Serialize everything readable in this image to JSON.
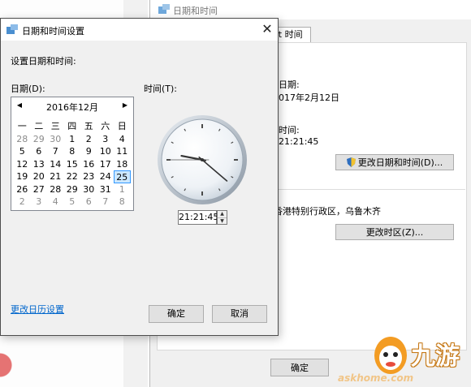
{
  "background_dialog": {
    "title": "日期和时间",
    "tab_label": "et 时间",
    "date_label": "日期:",
    "date_value": "017年2月12日",
    "time_label": "时间:",
    "time_value": "21:21:45",
    "change_datetime_button": "更改日期和时间(D)...",
    "timezone_value": "香港特别行政区，乌鲁木齐",
    "change_timezone_button": "更改时区(Z)...",
    "ok_button": "确定"
  },
  "watermark": {
    "brand": "九游",
    "url": "askhome.com"
  },
  "dialog": {
    "title": "日期和时间设置",
    "close_glyph": "✕",
    "heading": "设置日期和时间:",
    "date_label": "日期(D):",
    "time_label": "时间(T):",
    "calendar": {
      "month_label": "2016年12月",
      "prev_glyph": "◀",
      "next_glyph": "▶",
      "weekdays": [
        "一",
        "二",
        "三",
        "四",
        "五",
        "六",
        "日"
      ],
      "weeks": [
        [
          "28",
          "29",
          "30",
          "1",
          "2",
          "3",
          "4"
        ],
        [
          "5",
          "6",
          "7",
          "8",
          "9",
          "10",
          "11"
        ],
        [
          "12",
          "13",
          "14",
          "15",
          "16",
          "17",
          "18"
        ],
        [
          "19",
          "20",
          "21",
          "22",
          "23",
          "24",
          "25"
        ],
        [
          "26",
          "27",
          "28",
          "29",
          "30",
          "31",
          "1"
        ],
        [
          "2",
          "3",
          "4",
          "5",
          "6",
          "7",
          "8"
        ]
      ],
      "other_month_cells": [
        [
          0,
          0
        ],
        [
          0,
          1
        ],
        [
          0,
          2
        ],
        [
          4,
          6
        ],
        [
          5,
          0
        ],
        [
          5,
          1
        ],
        [
          5,
          2
        ],
        [
          5,
          3
        ],
        [
          5,
          4
        ],
        [
          5,
          5
        ],
        [
          5,
          6
        ]
      ],
      "selected_cell": [
        3,
        6
      ]
    },
    "time_value": "21:21:45",
    "clock": {
      "hour": 21,
      "minute": 21,
      "second": 45
    },
    "change_calendar_link": "更改日历设置",
    "ok_button": "确定",
    "cancel_button": "取消"
  }
}
